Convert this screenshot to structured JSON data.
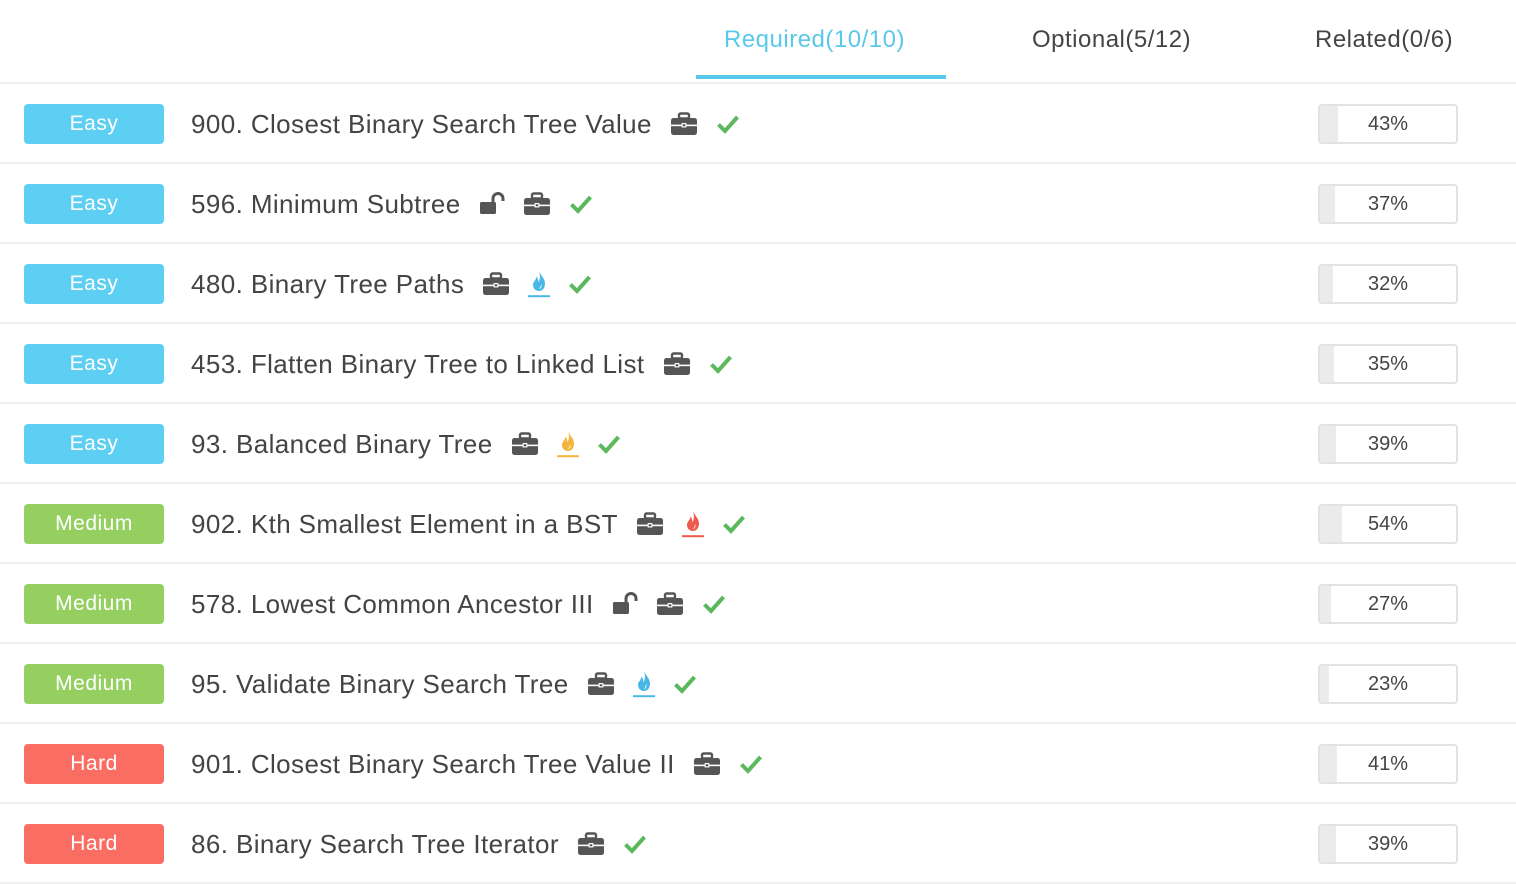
{
  "tabs": [
    {
      "label": "Required(10/10)",
      "active": true
    },
    {
      "label": "Optional(5/12)",
      "active": false
    },
    {
      "label": "Related(0/6)",
      "active": false
    }
  ],
  "colors": {
    "accent": "#5ac8ea",
    "easy": "#5ccff2",
    "medium": "#94cf5f",
    "hard": "#f96d63",
    "check": "#5cb85c",
    "icon_dark": "#555555"
  },
  "problems": [
    {
      "difficulty": "Easy",
      "title": "900. Closest Binary Search Tree Value",
      "icons": [
        "briefcase-icon",
        "check-icon"
      ],
      "rate": "43%",
      "rate_value": 43
    },
    {
      "difficulty": "Easy",
      "title": "596. Minimum Subtree",
      "icons": [
        "unlock-icon",
        "briefcase-icon",
        "check-icon"
      ],
      "rate": "37%",
      "rate_value": 37
    },
    {
      "difficulty": "Easy",
      "title": "480. Binary Tree Paths",
      "icons": [
        "briefcase-icon",
        "flame-blue-icon",
        "check-icon"
      ],
      "rate": "32%",
      "rate_value": 32
    },
    {
      "difficulty": "Easy",
      "title": "453. Flatten Binary Tree to Linked List",
      "icons": [
        "briefcase-icon",
        "check-icon"
      ],
      "rate": "35%",
      "rate_value": 35
    },
    {
      "difficulty": "Easy",
      "title": "93. Balanced Binary Tree",
      "icons": [
        "briefcase-icon",
        "flame-orange-icon",
        "check-icon"
      ],
      "rate": "39%",
      "rate_value": 39
    },
    {
      "difficulty": "Medium",
      "title": "902. Kth Smallest Element in a BST",
      "icons": [
        "briefcase-icon",
        "flame-red-icon",
        "check-icon"
      ],
      "rate": "54%",
      "rate_value": 54
    },
    {
      "difficulty": "Medium",
      "title": "578. Lowest Common Ancestor III",
      "icons": [
        "unlock-icon",
        "briefcase-icon",
        "check-icon"
      ],
      "rate": "27%",
      "rate_value": 27
    },
    {
      "difficulty": "Medium",
      "title": "95. Validate Binary Search Tree",
      "icons": [
        "briefcase-icon",
        "flame-blue-icon",
        "check-icon"
      ],
      "rate": "23%",
      "rate_value": 23
    },
    {
      "difficulty": "Hard",
      "title": "901. Closest Binary Search Tree Value II",
      "icons": [
        "briefcase-icon",
        "check-icon"
      ],
      "rate": "41%",
      "rate_value": 41
    },
    {
      "difficulty": "Hard",
      "title": "86. Binary Search Tree Iterator",
      "icons": [
        "briefcase-icon",
        "check-icon"
      ],
      "rate": "39%",
      "rate_value": 39
    }
  ]
}
